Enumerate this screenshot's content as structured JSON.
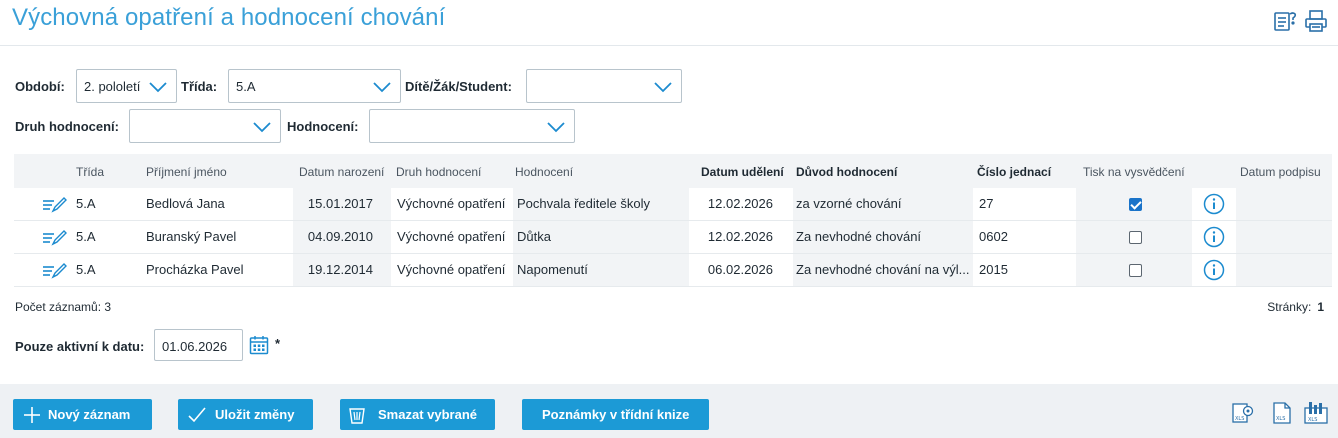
{
  "page": {
    "title": "Výchovná opatření a hodnocení chování"
  },
  "toolbar_icons": [
    "help-list-icon",
    "print-icon"
  ],
  "filters": {
    "period": {
      "label": "Období:",
      "value": "2. pololetí"
    },
    "class": {
      "label": "Třída:",
      "value": "5.A"
    },
    "child": {
      "label": "Dítě/Žák/Student:",
      "value": ""
    },
    "rating_type": {
      "label": "Druh hodnocení:",
      "value": ""
    },
    "rating": {
      "label": "Hodnocení:",
      "value": ""
    }
  },
  "table": {
    "headers": {
      "class": "Třída",
      "name": "Příjmení jméno",
      "birth": "Datum narození",
      "type": "Druh hodnocení",
      "rating": "Hodnocení",
      "granted": "Datum udělení",
      "reason": "Důvod hodnocení",
      "ref": "Číslo jednací",
      "print": "Tisk na vysvědčení",
      "signed": "Datum podpisu"
    },
    "rows": [
      {
        "class": "5.A",
        "name": "Bedlová Jana",
        "birth": "15.01.2017",
        "type": "Výchovné opatření",
        "rating": "Pochvala ředitele školy",
        "granted": "12.02.2026",
        "reason": "za vzorné chování",
        "ref": "27",
        "print": true,
        "signed": ""
      },
      {
        "class": "5.A",
        "name": "Buranský Pavel",
        "birth": "04.09.2010",
        "type": "Výchovné opatření",
        "rating": "Důtka",
        "granted": "12.02.2026",
        "reason": "Za nevhodné chování",
        "ref": "0602",
        "print": false,
        "signed": ""
      },
      {
        "class": "5.A",
        "name": "Procházka Pavel",
        "birth": "19.12.2014",
        "type": "Výchovné opatření",
        "rating": "Napomenutí",
        "granted": "06.02.2026",
        "reason": "Za nevhodné chování na výl...",
        "ref": "2015",
        "print": false,
        "signed": ""
      }
    ]
  },
  "footer": {
    "count_label": "Počet záznamů: 3",
    "pages_label": "Stránky:",
    "page_number": "1"
  },
  "active_date": {
    "label": "Pouze aktivní k datu:",
    "value": "01.06.2026",
    "required_mark": "*"
  },
  "buttons": {
    "new": "Nový záznam",
    "save": "Uložit změny",
    "delete": "Smazat vybrané",
    "notes": "Poznámky v třídní knize"
  },
  "export_icons": [
    "export-xls-settings-icon",
    "export-xls-icon",
    "export-chart-icon"
  ],
  "colors": {
    "accent": "#1c9ad6",
    "title": "#3aa0d8",
    "header_bg": "#f2f4f6"
  }
}
